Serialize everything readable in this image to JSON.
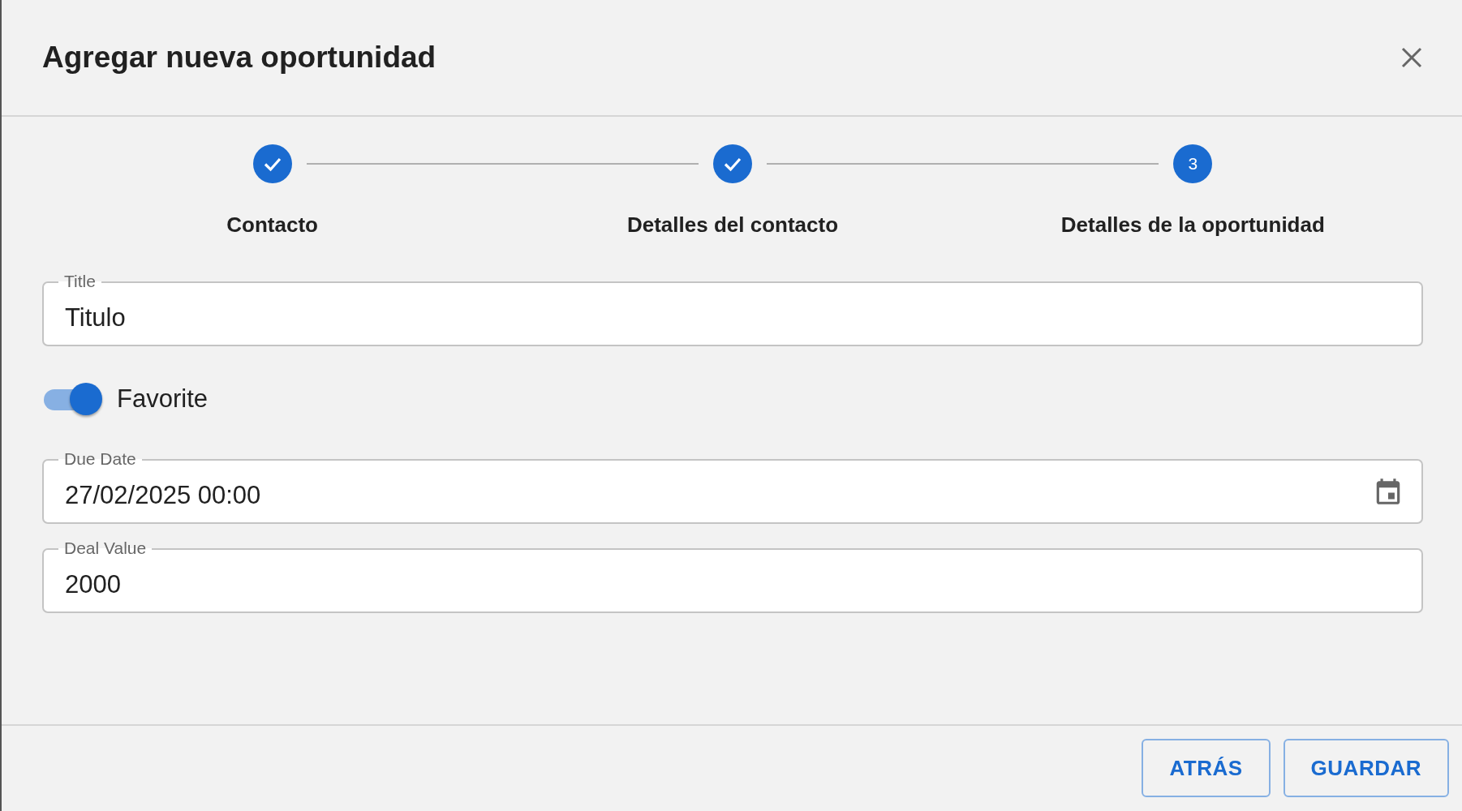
{
  "dialog": {
    "title": "Agregar nueva oportunidad"
  },
  "steps": [
    {
      "label": "Contacto",
      "kind": "done"
    },
    {
      "label": "Detalles del contacto",
      "kind": "done"
    },
    {
      "label": "Detalles de la oportunidad",
      "kind": "active",
      "marker": "3"
    }
  ],
  "fields": [
    {
      "kind": "text",
      "label": "Title",
      "value": "Titulo"
    },
    {
      "kind": "toggle",
      "label": "Favorite",
      "on": true
    },
    {
      "kind": "date",
      "label": "Due Date",
      "value": "27/02/2025 00:00"
    },
    {
      "kind": "text",
      "label": "Deal Value",
      "value": "2000"
    }
  ],
  "buttons": [
    {
      "label": "ATRÁS"
    },
    {
      "label": "GUARDAR"
    }
  ]
}
